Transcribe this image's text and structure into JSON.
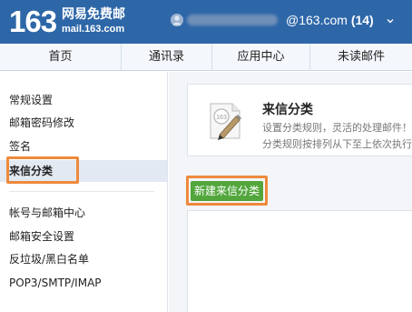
{
  "header": {
    "logo_number": "163",
    "logo_name": "网易免费邮",
    "logo_domain": "mail.163.com",
    "user_domain": "@163.com",
    "unread_count": "(14)"
  },
  "nav": {
    "tabs": [
      {
        "label": "首页"
      },
      {
        "label": "通讯录"
      },
      {
        "label": "应用中心"
      },
      {
        "label": "未读邮件"
      }
    ]
  },
  "sidebar": {
    "items": [
      {
        "label": "常规设置"
      },
      {
        "label": "邮箱密码修改"
      },
      {
        "label": "签名"
      },
      {
        "label": "来信分类",
        "active": true
      },
      {
        "label": "帐号与邮箱中心"
      },
      {
        "label": "邮箱安全设置"
      },
      {
        "label": "反垃圾/黑白名单"
      },
      {
        "label": "POP3/SMTP/IMAP"
      }
    ]
  },
  "main": {
    "title": "来信分类",
    "desc_line1": "设置分类规则，灵活的处理邮件！",
    "desc_line2": "分类规则按排列从下至上依次执行",
    "icon_label": "163",
    "new_button": "新建来信分类"
  },
  "colors": {
    "header_bg": "#2e67a8",
    "highlight": "#ee8a3c",
    "button_green": "#52a63c",
    "active_item_bg": "#e2e9f2"
  }
}
